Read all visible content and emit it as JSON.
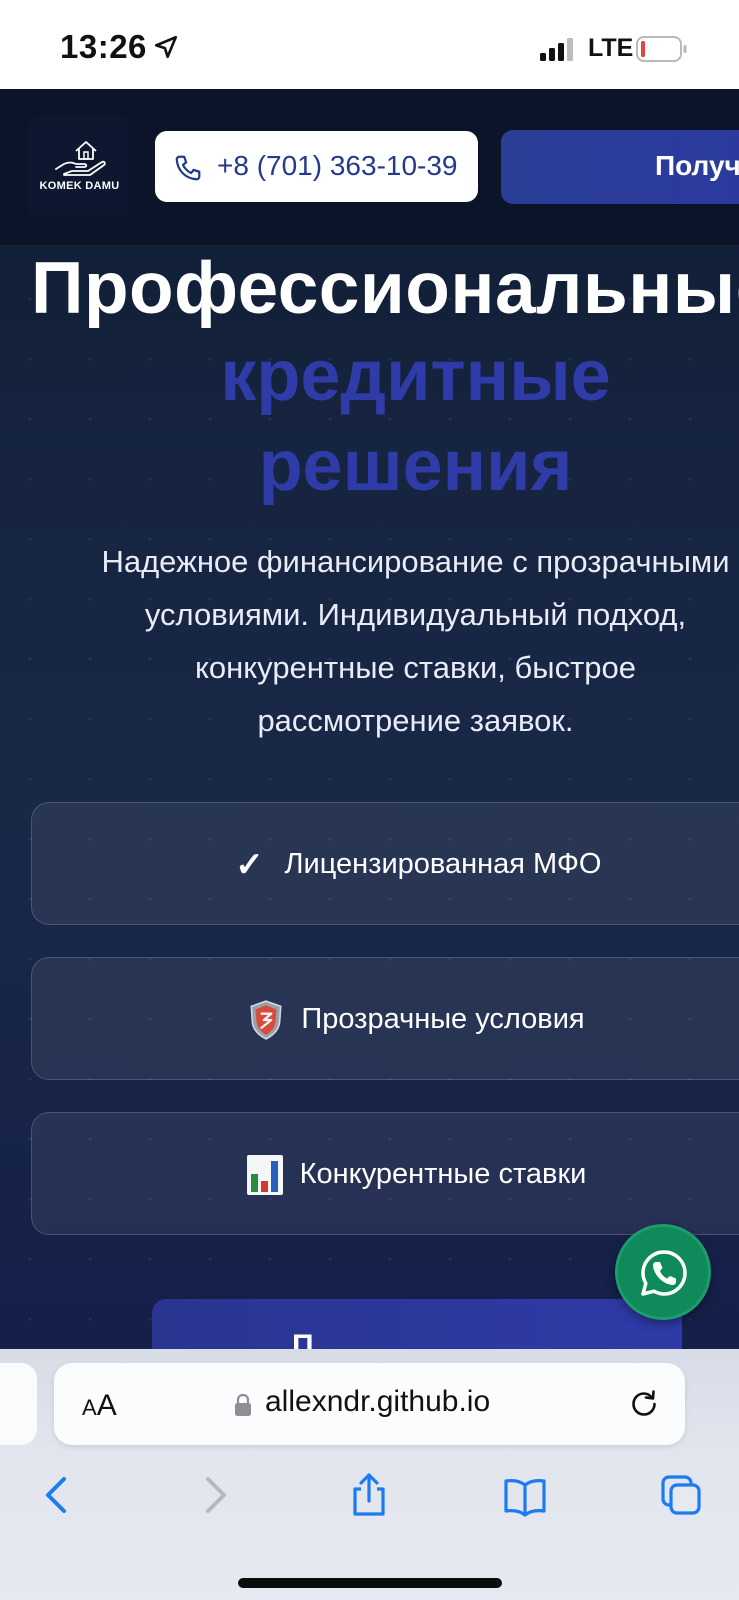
{
  "status_bar": {
    "time": "13:26",
    "network": "LTE",
    "battery_color": "#e0463c"
  },
  "header": {
    "logo_text": "KOMEK DAMU",
    "phone": "+8 (701) 363-10-39",
    "cta_label": "Получить"
  },
  "hero": {
    "title": "Профессиональные",
    "accent_line1": "кредитные",
    "accent_line2": "решения",
    "subtitle_lines": [
      "Надежное финансирование с прозрачными",
      "условиями. Индивидуальный подход,",
      "конкурентные ставки, быстрое",
      "рассмотрение заявок."
    ]
  },
  "features": [
    {
      "icon": "check-icon",
      "label": "Лицензированная МФО"
    },
    {
      "icon": "shield-icon",
      "label": "Прозрачные условия"
    },
    {
      "icon": "bar-chart-icon",
      "label": "Конкурентные ставки"
    }
  ],
  "bottom_button": {
    "label": "П"
  },
  "browser": {
    "text_size_label_small": "A",
    "text_size_label_big": "A",
    "url": "allexndr.github.io"
  },
  "colors": {
    "accent": "#2f3ba6",
    "page_bg": "#172448",
    "whatsapp": "#0f8a5b",
    "safari_blue": "#1b7cf2"
  }
}
